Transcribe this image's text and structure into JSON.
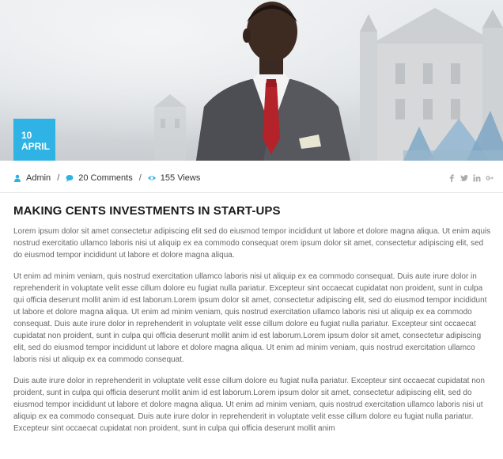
{
  "post": {
    "date": {
      "day": "10",
      "month": "APRIL"
    },
    "meta": {
      "author": "Admin",
      "comments": "20 Comments",
      "views": "155 Views",
      "separator": "/"
    },
    "social": [
      "facebook-icon",
      "twitter-icon",
      "linkedin-icon",
      "google-plus-icon"
    ],
    "title": "MAKING CENTS INVESTMENTS IN START-UPS",
    "paragraphs": [
      "Lorem ipsum dolor sit amet consectetur adipiscing elit sed do eiusmod tempor incididunt ut labore et dolore magna aliqua. Ut enim aquis nostrud exercitatio ullamco laboris nisi ut aliquip ex ea commodo consequat orem ipsum dolor sit amet, consectetur adipiscing elit, sed do eiusmod tempor incididunt ut labore et dolore magna aliqua.",
      "Ut enim ad minim veniam, quis nostrud exercitation ullamco laboris nisi ut aliquip ex ea commodo consequat. Duis aute irure dolor in reprehenderit in voluptate velit esse cillum dolore eu fugiat nulla pariatur. Excepteur sint occaecat cupidatat non proident, sunt in culpa qui officia deserunt mollit anim id est laborum.Lorem ipsum dolor sit amet, consectetur adipiscing elit, sed do eiusmod tempor incididunt ut labore et dolore magna aliqua. Ut enim ad minim veniam, quis nostrud exercitation ullamco laboris nisi ut aliquip ex ea commodo consequat. Duis aute irure dolor in reprehenderit in voluptate velit esse cillum dolore eu fugiat nulla pariatur. Excepteur sint occaecat cupidatat non proident, sunt in culpa qui officia deserunt mollit anim id est laborum.Lorem ipsum dolor sit amet, consectetur adipiscing elit, sed do eiusmod tempor incididunt ut labore et dolore magna aliqua. Ut enim ad minim veniam, quis nostrud exercitation ullamco laboris nisi ut aliquip ex ea commodo consequat.",
      "Duis aute irure dolor in reprehenderit in voluptate velit esse cillum dolore eu fugiat nulla pariatur. Excepteur sint occaecat cupidatat non proident, sunt in culpa qui officia deserunt mollit anim id est laborum.Lorem ipsum dolor sit amet, consectetur adipiscing elit, sed do eiusmod tempor incididunt ut labore et dolore magna aliqua. Ut enim ad minim veniam, quis nostrud exercitation ullamco laboris nisi ut aliquip ex ea commodo consequat. Duis aute irure dolor in reprehenderit in voluptate velit esse cillum dolore eu fugiat nulla pariatur. Excepteur sint occaecat cupidatat non proident, sunt in culpa qui officia deserunt mollit anim"
    ]
  },
  "colors": {
    "accent": "#2eb3e4",
    "title": "#1a1a1a",
    "body_text": "#666666",
    "social_icons": "#aaaaaa"
  }
}
